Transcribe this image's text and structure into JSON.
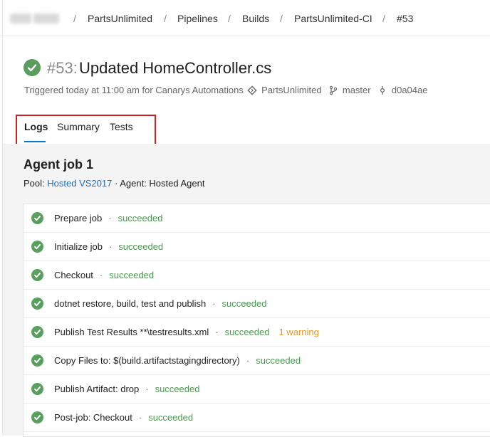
{
  "breadcrumb": {
    "items": [
      "PartsUnlimited",
      "Pipelines",
      "Builds",
      "PartsUnlimited-CI",
      "#53"
    ],
    "separator": "/"
  },
  "build": {
    "number": "#53:",
    "title": "Updated HomeController.cs",
    "trigger_text": "Triggered today at 11:00 am for Canarys Automations",
    "repo": "PartsUnlimited",
    "branch": "master",
    "commit": "d0a04ae"
  },
  "tabs": [
    "Logs",
    "Summary",
    "Tests"
  ],
  "job": {
    "title": "Agent job 1",
    "pool_label": "Pool:",
    "pool_value": "Hosted VS2017",
    "agent_text": "Agent: Hosted Agent",
    "separator": "·"
  },
  "steps": [
    {
      "name": "Prepare job",
      "status": "succeeded",
      "warning": ""
    },
    {
      "name": "Initialize job",
      "status": "succeeded",
      "warning": ""
    },
    {
      "name": "Checkout",
      "status": "succeeded",
      "warning": ""
    },
    {
      "name": "dotnet restore, build, test and publish",
      "status": "succeeded",
      "warning": ""
    },
    {
      "name": "Publish Test Results **\\testresults.xml",
      "status": "succeeded",
      "warning": "1 warning"
    },
    {
      "name": "Copy Files to: $(build.artifactstagingdirectory)",
      "status": "succeeded",
      "warning": ""
    },
    {
      "name": "Publish Artifact: drop",
      "status": "succeeded",
      "warning": ""
    },
    {
      "name": "Post-job: Checkout",
      "status": "succeeded",
      "warning": ""
    }
  ],
  "colors": {
    "success": "#5a9e5f",
    "success_text": "#4a9a4f",
    "warning": "#e3962c",
    "link": "#1c6ec4",
    "tab_underline": "#0078d4",
    "highlight_box": "#cc2222"
  }
}
